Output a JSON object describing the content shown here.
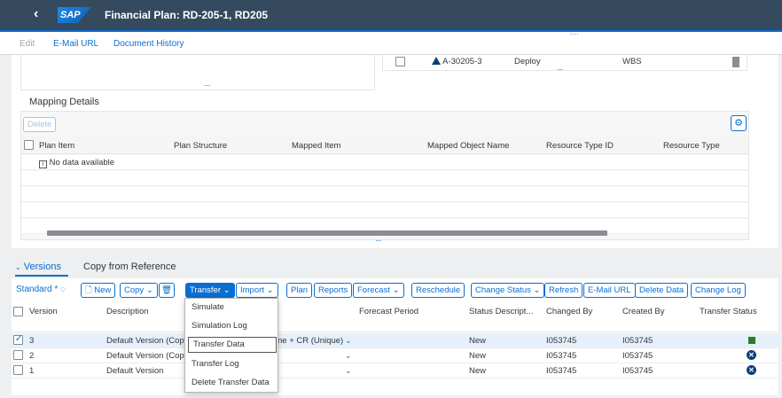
{
  "shell": {
    "title": "Financial Plan: RD-205-1, RD205",
    "logo": "SAP",
    "back_icon": "chevron-left-icon"
  },
  "subtoolbar": {
    "edit": "Edit",
    "email_url": "E-Mail URL",
    "doc_history": "Document History"
  },
  "upper_right_row": {
    "id": "A-30205-3",
    "col2": "Deploy",
    "col3": "WBS"
  },
  "mapping": {
    "title": "Mapping Details",
    "delete_label": "Delete",
    "columns": [
      "Plan Item",
      "Plan Structure",
      "Mapped Item",
      "Mapped Object Name",
      "Resource Type ID",
      "Resource Type"
    ],
    "no_data": "No data available"
  },
  "tabs": {
    "versions": "Versions",
    "copy_ref": "Copy from Reference"
  },
  "toolbar": {
    "standard": "Standard *",
    "new": "New",
    "copy": "Copy",
    "transfer": "Transfer",
    "import": "Import",
    "plan": "Plan",
    "reports": "Reports",
    "forecast": "Forecast",
    "reschedule": "Reschedule",
    "change_status": "Change Status",
    "refresh": "Refresh",
    "email_url": "E-Mail URL",
    "delete_data": "Delete Data",
    "change_log": "Change Log"
  },
  "versions_table": {
    "columns": {
      "version": "Version",
      "description": "Description",
      "forecast_period": "Forecast Period",
      "status_desc": "Status Descript...",
      "changed_by": "Changed By",
      "created_by": "Created By",
      "transfer_status": "Transfer Status"
    },
    "rows": [
      {
        "version": "3",
        "description": "Default Version (Copy",
        "extra": "ne + CR (Unique)",
        "status": "New",
        "changed_by": "I053745",
        "created_by": "I053745",
        "transfer": "ok",
        "checked": true
      },
      {
        "version": "2",
        "description": "Default Version (Copy",
        "extra": "",
        "status": "New",
        "changed_by": "I053745",
        "created_by": "I053745",
        "transfer": "error",
        "checked": false
      },
      {
        "version": "1",
        "description": "Default Version",
        "extra": "",
        "status": "New",
        "changed_by": "I053745",
        "created_by": "I053745",
        "transfer": "error",
        "checked": false
      }
    ]
  },
  "transfer_menu": [
    "Simulate",
    "Simulation Log",
    "Transfer Data",
    "Transfer Log",
    "Delete Transfer Data"
  ],
  "colors": {
    "shell": "#354a5f",
    "accent": "#0a6ed1",
    "success": "#2b7d2b",
    "error": "#0a3f7a"
  }
}
